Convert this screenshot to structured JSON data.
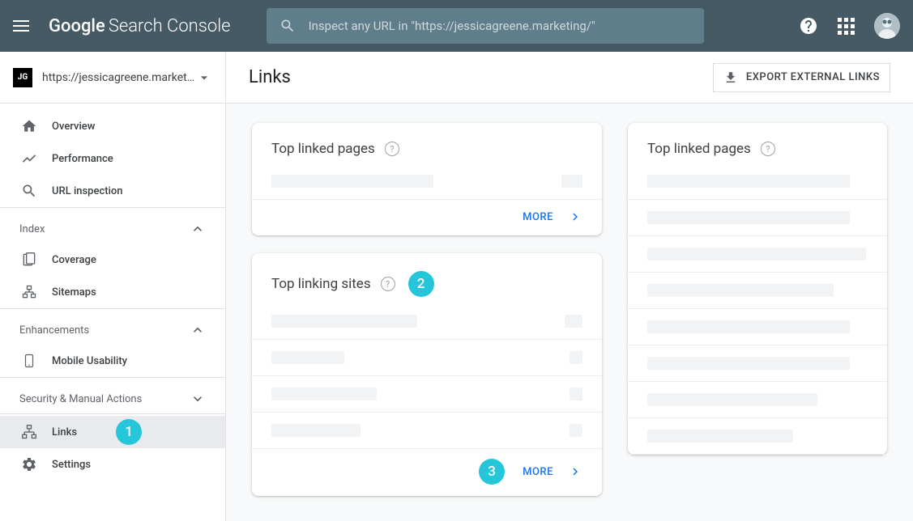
{
  "header": {
    "logo_google": "Google",
    "logo_sc": "Search Console",
    "search_placeholder": "Inspect any URL in \"https://jessicagreene.marketing/\""
  },
  "sidebar": {
    "property_icon_text": "JG",
    "property_label": "https://jessicagreene.marketi…",
    "overview": "Overview",
    "performance": "Performance",
    "url_inspection": "URL inspection",
    "section_index": "Index",
    "coverage": "Coverage",
    "sitemaps": "Sitemaps",
    "section_enhancements": "Enhancements",
    "mobile_usability": "Mobile Usability",
    "section_security": "Security & Manual Actions",
    "links": "Links",
    "settings": "Settings"
  },
  "page": {
    "title": "Links",
    "export_label": "EXPORT EXTERNAL LINKS"
  },
  "cards": {
    "top_linked_pages_1": "Top linked pages",
    "top_linking_sites": "Top linking sites",
    "top_linked_pages_2": "Top linked pages",
    "more": "MORE"
  },
  "annotations": {
    "badge1": "1",
    "badge2": "2",
    "badge3": "3"
  }
}
